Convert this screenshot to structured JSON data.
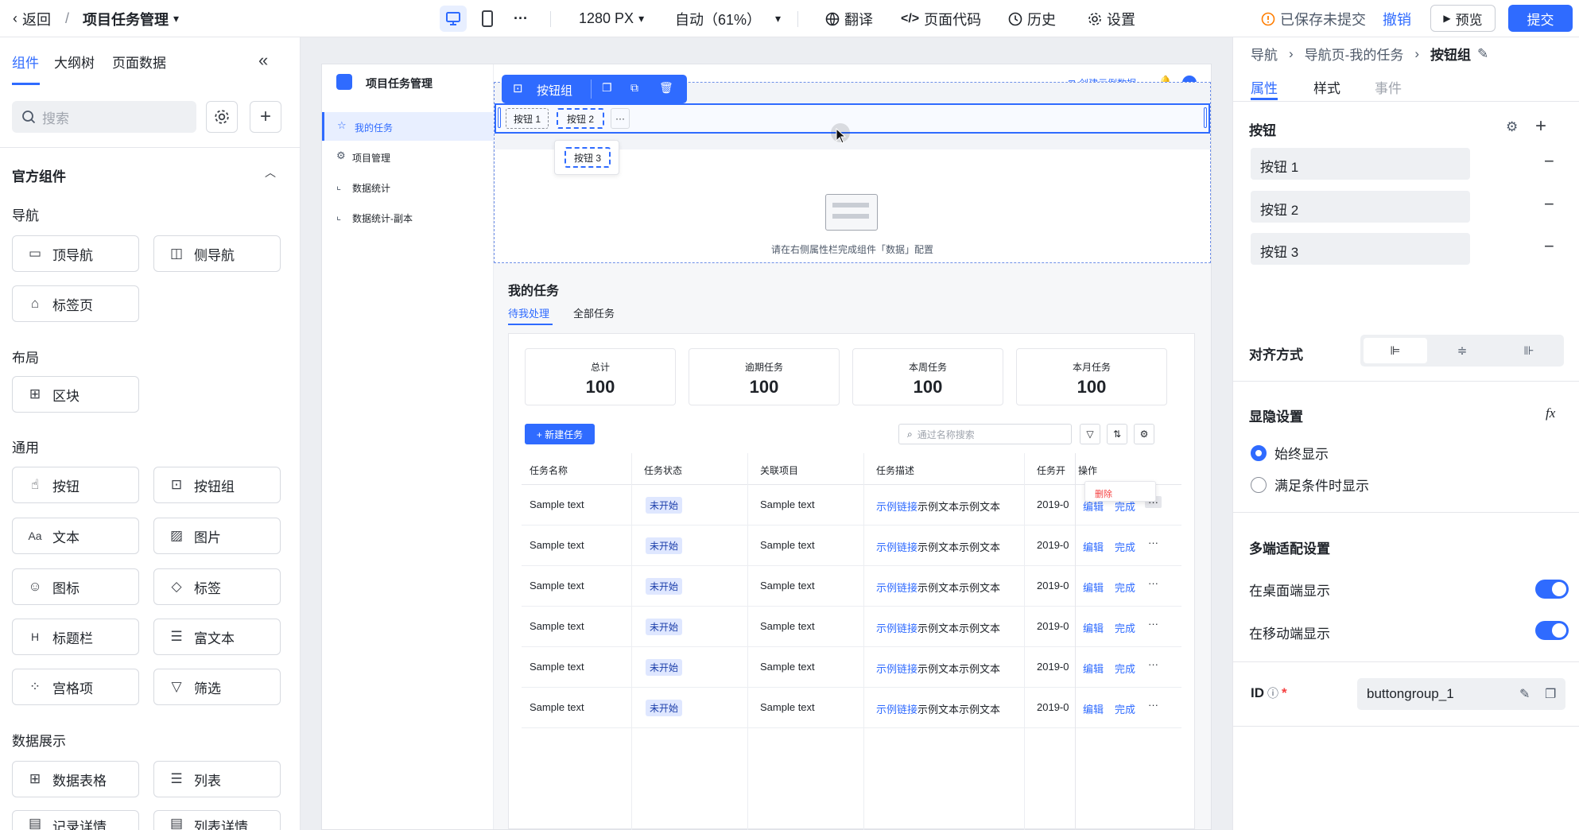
{
  "topbar": {
    "back_label": "返回",
    "slash": "/",
    "project_name": "项目任务管理",
    "more_dots": "···",
    "resolution": "1280 PX",
    "zoom": "自动（61%）",
    "translate": "翻译",
    "page_code": "页面代码",
    "history": "历史",
    "settings": "设置",
    "saved_status": "已保存未提交",
    "undo": "撤销",
    "preview": "预览",
    "submit": "提交"
  },
  "left": {
    "tabs": [
      "组件",
      "大纲树",
      "页面数据"
    ],
    "search_placeholder": "搜索",
    "official_title": "官方组件",
    "sections": {
      "nav": "导航",
      "layout": "布局",
      "general": "通用",
      "data": "数据展示"
    },
    "components": {
      "top_nav": "顶导航",
      "side_nav": "侧导航",
      "tab_page": "标签页",
      "block": "区块",
      "button": "按钮",
      "button_group": "按钮组",
      "text": "文本",
      "image": "图片",
      "icon": "图标",
      "tag": "标签",
      "title_bar": "标题栏",
      "rich_text": "富文本",
      "grid_item": "宫格项",
      "filter": "筛选",
      "data_table": "数据表格",
      "list": "列表",
      "record_detail": "记录详情",
      "list_detail": "列表详情"
    }
  },
  "app": {
    "title": "项目任务管理",
    "nav": [
      "我的任务",
      "项目管理",
      "数据统计",
      "数据统计-副本"
    ],
    "create_sample": "创建示例数据",
    "avatar_text": "",
    "toolbar_label": "按钮组",
    "btns": [
      "按钮 1",
      "按钮 2",
      "按钮 3"
    ],
    "more": "···",
    "empty_text": "请在右侧属性栏完成组件「数据」配置",
    "section_title": "我的任务",
    "tabs": [
      "待我处理",
      "全部任务"
    ],
    "stats": [
      {
        "label": "总计",
        "value": "100"
      },
      {
        "label": "逾期任务",
        "value": "100"
      },
      {
        "label": "本周任务",
        "value": "100"
      },
      {
        "label": "本月任务",
        "value": "100"
      }
    ],
    "new_task": "+ 新建任务",
    "search_placeholder": "通过名称搜索",
    "columns": [
      "任务名称",
      "任务状态",
      "关联项目",
      "任务描述",
      "任务开",
      "操作"
    ],
    "delete": "删除",
    "row": {
      "name": "Sample text",
      "status": "未开始",
      "project": "Sample text",
      "desc_link": "示例链接",
      "desc_text": "示例文本示例文本",
      "date": "2019-0",
      "edit": "编辑",
      "done": "完成"
    }
  },
  "right": {
    "breadcrumb": [
      "导航",
      "导航页-我的任务",
      "按钮组"
    ],
    "tabs": [
      "属性",
      "样式",
      "事件"
    ],
    "button_section": "按钮",
    "buttons": [
      "按钮 1",
      "按钮 2",
      "按钮 3"
    ],
    "align_label": "对齐方式",
    "visibility_title": "显隐设置",
    "fx": "fx",
    "vis_options": [
      "始终显示",
      "满足条件时显示"
    ],
    "multi_title": "多端适配设置",
    "desktop": "在桌面端显示",
    "mobile": "在移动端显示",
    "id_label": "ID",
    "id_value": "buttongroup_1"
  },
  "colors": {
    "accent": "#2f6bff",
    "danger": "#f53f3f"
  }
}
